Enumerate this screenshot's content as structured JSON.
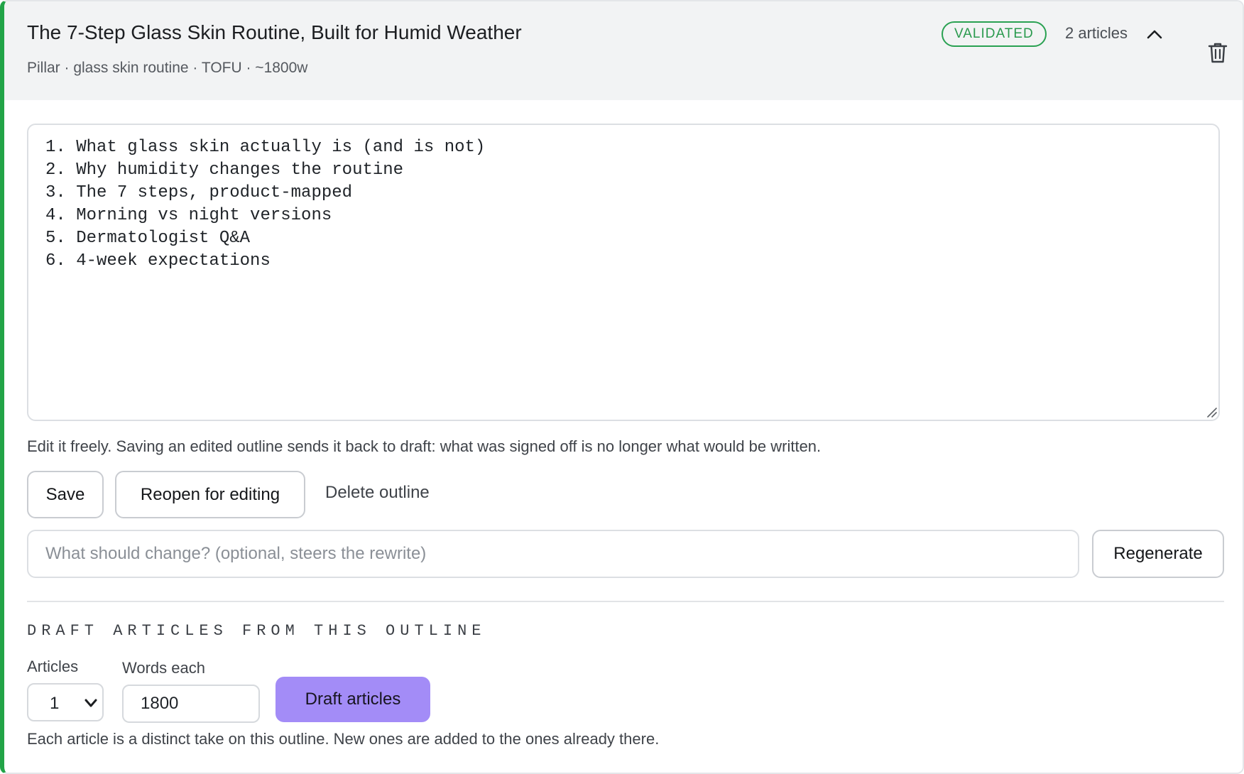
{
  "header": {
    "title": "The 7-Step Glass Skin Routine, Built for Humid Weather",
    "subtitle": "Pillar · glass skin routine · TOFU · ~1800w",
    "status_badge": "VALIDATED",
    "article_count": "2 articles",
    "collapse_icon": "chevron-up-icon",
    "delete_icon": "trash-icon"
  },
  "outline": {
    "text": "1. What glass skin actually is (and is not)\n2. Why humidity changes the routine\n3. The 7 steps, product-mapped\n4. Morning vs night versions\n5. Dermatologist Q&A\n6. 4-week expectations"
  },
  "hint": "Edit it freely. Saving an edited outline sends it back to draft: what was signed off is no longer what would be written.",
  "actions": {
    "save_label": "Save",
    "reopen_label": "Reopen for editing",
    "delete_label": "Delete outline"
  },
  "regenerate": {
    "placeholder": "What should change? (optional, steers the rewrite)",
    "button_label": "Regenerate"
  },
  "draft": {
    "section_title": "DRAFT ARTICLES FROM THIS OUTLINE",
    "articles_label": "Articles",
    "articles_value": "1",
    "words_label": "Words each",
    "words_value": "1800",
    "button_label": "Draft articles",
    "footnote": "Each article is a distinct take on this outline. New ones are added to the ones already there."
  },
  "colors": {
    "accent_green": "#22a447",
    "draft_button": "#a38cf7"
  }
}
